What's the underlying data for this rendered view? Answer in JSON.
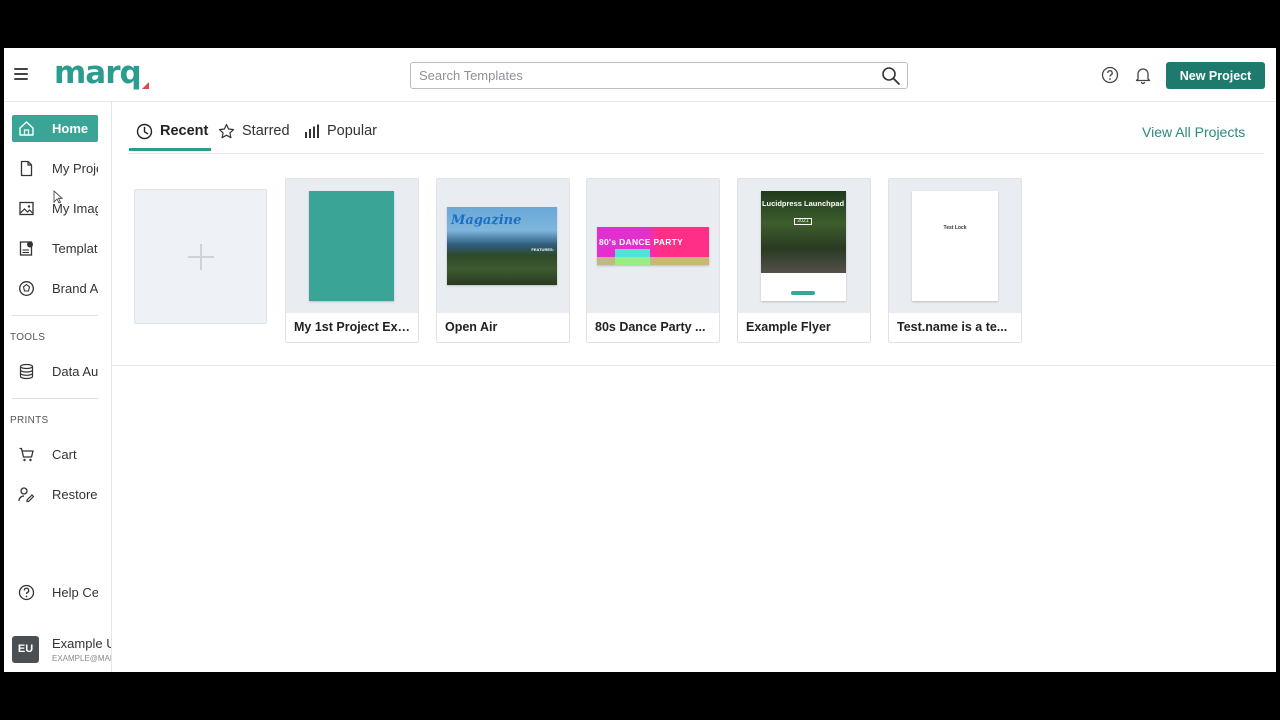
{
  "app": {
    "logo": "marq",
    "brand_color": "#2a9d8f",
    "accent_dark": "#1f7a6e"
  },
  "header": {
    "search_placeholder": "Search Templates",
    "new_project_label": "New Project"
  },
  "sidebar": {
    "items": [
      {
        "label": "Home",
        "icon": "home-icon",
        "active": true
      },
      {
        "label": "My Proje",
        "icon": "document-icon"
      },
      {
        "label": "My Imag",
        "icon": "image-icon"
      },
      {
        "label": "Templat",
        "icon": "template-icon"
      },
      {
        "label": "Brand A",
        "icon": "palette-icon"
      }
    ],
    "tools_heading": "TOOLS",
    "tools_items": [
      {
        "label": "Data Au",
        "icon": "database-icon"
      }
    ],
    "prints_heading": "PRINTS",
    "prints_items": [
      {
        "label": "Cart",
        "icon": "cart-icon"
      },
      {
        "label": "Restore",
        "icon": "restore-icon"
      }
    ],
    "help_label": "Help Ce",
    "user": {
      "initials": "EU",
      "name": "Example U",
      "email": "EXAMPLE@MAR"
    }
  },
  "tabs": [
    {
      "label": "Recent",
      "icon": "clock-icon",
      "active": true
    },
    {
      "label": "Starred",
      "icon": "star-icon"
    },
    {
      "label": "Popular",
      "icon": "bar-chart-icon"
    }
  ],
  "view_all_label": "View All Projects",
  "projects": [
    {
      "name": "My 1st Project Exa...",
      "thumb_color": "#3aa597"
    },
    {
      "name": "Open Air",
      "thumb_text": "Magazine",
      "thumb_sub": "FEATURES:"
    },
    {
      "name": "80s Dance Party ...",
      "thumb_text": "80's DANCE PARTY"
    },
    {
      "name": "Example Flyer",
      "thumb_text": "Lucidpress Launchpad",
      "thumb_sub": "2021"
    },
    {
      "name": "Test.name is a te...",
      "thumb_text": "Test Lock"
    }
  ]
}
